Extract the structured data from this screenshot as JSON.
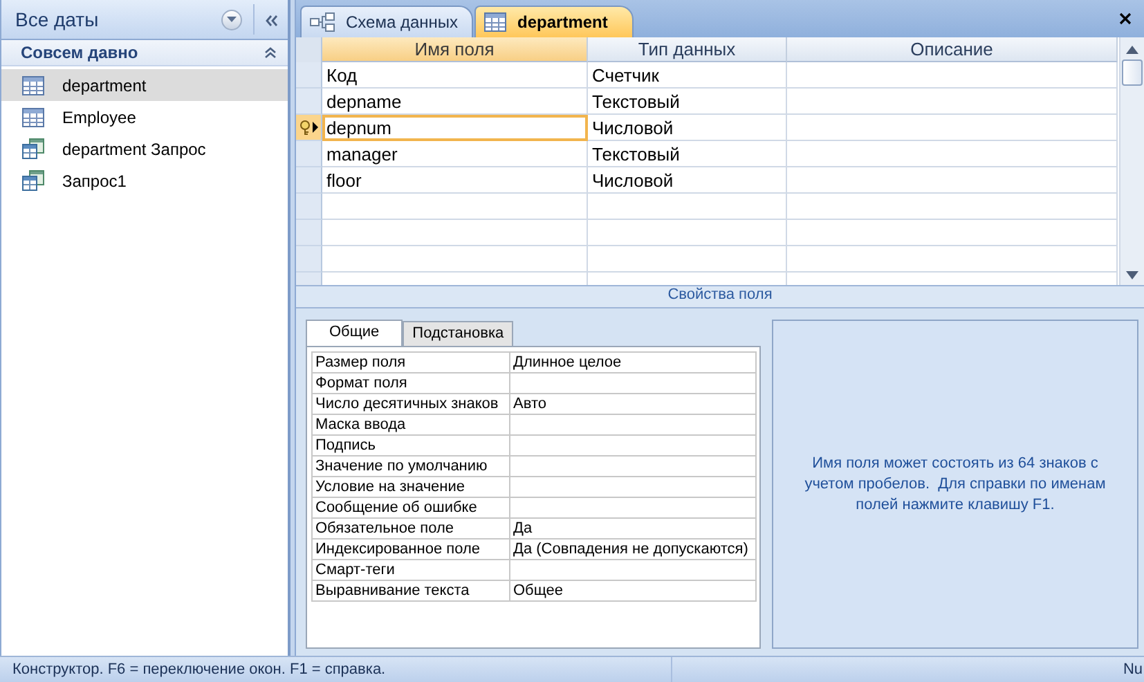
{
  "nav_pane": {
    "title": "Все даты",
    "group": {
      "label": "Совсем давно",
      "expanded": true
    },
    "items": [
      {
        "kind": "table",
        "label": "department",
        "selected": true
      },
      {
        "kind": "table",
        "label": "Employee",
        "selected": false
      },
      {
        "kind": "query",
        "label": "department Запрос",
        "selected": false
      },
      {
        "kind": "query",
        "label": "Запрос1",
        "selected": false
      }
    ]
  },
  "document_tabs": [
    {
      "kind": "relationships",
      "label": "Схема данных",
      "selected": false
    },
    {
      "kind": "table",
      "label": "department",
      "selected": true
    }
  ],
  "design_grid": {
    "columns": [
      "Имя поля",
      "Тип данных",
      "Описание"
    ],
    "rows": [
      {
        "field": "Код",
        "type": "Счетчик",
        "primary_key": false,
        "selected": false
      },
      {
        "field": "depname",
        "type": "Текстовый",
        "primary_key": false,
        "selected": false
      },
      {
        "field": "depnum",
        "type": "Числовой",
        "primary_key": true,
        "selected": true
      },
      {
        "field": "manager",
        "type": "Текстовый",
        "primary_key": false,
        "selected": false
      },
      {
        "field": "floor",
        "type": "Числовой",
        "primary_key": false,
        "selected": false
      }
    ]
  },
  "field_properties": {
    "title": "Свойства поля",
    "tabs": [
      {
        "label": "Общие",
        "selected": true
      },
      {
        "label": "Подстановка",
        "selected": false
      }
    ],
    "rows": [
      {
        "name": "Размер поля",
        "value": "Длинное целое"
      },
      {
        "name": "Формат поля"
      },
      {
        "name": "Число десятичных знаков",
        "value": "Авто"
      },
      {
        "name": "Маска ввода"
      },
      {
        "name": "Подпись"
      },
      {
        "name": "Значение по умолчанию"
      },
      {
        "name": "Условие на значение"
      },
      {
        "name": "Сообщение об ошибке"
      },
      {
        "name": "Обязательное поле",
        "value": "Да"
      },
      {
        "name": "Индексированное поле",
        "value": "Да (Совпадения не допускаются)"
      },
      {
        "name": "Смарт-теги"
      },
      {
        "name": "Выравнивание текста",
        "value": "Общее"
      }
    ],
    "help": "Имя поля может состоять из 64 знаков с учетом пробелов.  Для справки по именам полей нажмите клавишу F1."
  },
  "status_bar": {
    "text": "Конструктор.  F6 = переключение окон.  F1 = справка.",
    "indicator": "Nu"
  }
}
